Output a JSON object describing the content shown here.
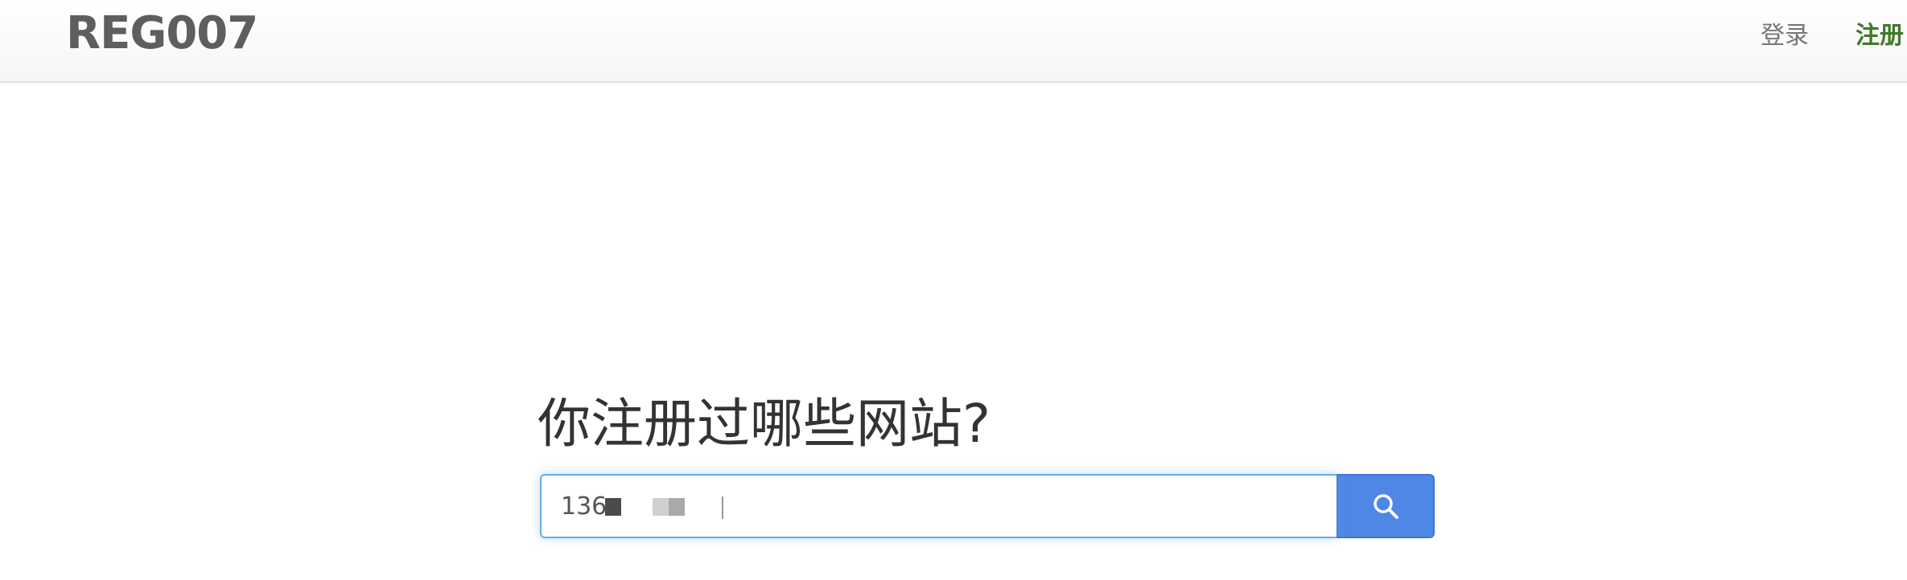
{
  "header": {
    "brand": "REG007",
    "nav": {
      "login_label": "登录",
      "register_label": "注册"
    }
  },
  "main": {
    "headline": "你注册过哪些网站?",
    "search": {
      "value": "136",
      "button_icon": "search-icon"
    }
  },
  "colors": {
    "brand_text": "#5e5e5e",
    "register_link": "#3f7a2a",
    "search_button": "#4f87e6",
    "input_focus_border": "#66afe9"
  }
}
